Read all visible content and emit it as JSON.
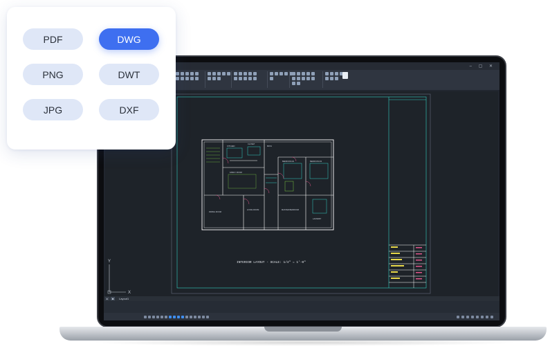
{
  "formats": {
    "buttons": [
      {
        "label": "PDF",
        "active": false
      },
      {
        "label": "DWG",
        "active": true
      },
      {
        "label": "PNG",
        "active": false
      },
      {
        "label": "DWT",
        "active": false
      },
      {
        "label": "JPG",
        "active": false
      },
      {
        "label": "DXF",
        "active": false
      }
    ]
  },
  "cad": {
    "layout_tab": "Layout1",
    "drawing_caption": "INTERIOR LAYOUT  -  SCALE: 1/4\" = 1'-0\"",
    "ucs_x": "X",
    "ucs_y": "Y",
    "room_labels": [
      "DINING ROOM",
      "LIVING ROOM",
      "MASTER BEDROOM",
      "BEDROOM #2",
      "BEDROOM #3",
      "FAMILY ROOM",
      "KITCHEN",
      "BATH",
      "CLOSET",
      "LAUNDRY"
    ],
    "colors": {
      "line_primary": "#ffffff",
      "line_accent": "#33d1c4",
      "line_highlight": "#e0568a",
      "titleblock_text": "#e8d84a",
      "canvas_bg": "#1e2329"
    }
  },
  "theme": {
    "accent": "#3e6ff0",
    "pill_bg": "#dfe7f7"
  }
}
